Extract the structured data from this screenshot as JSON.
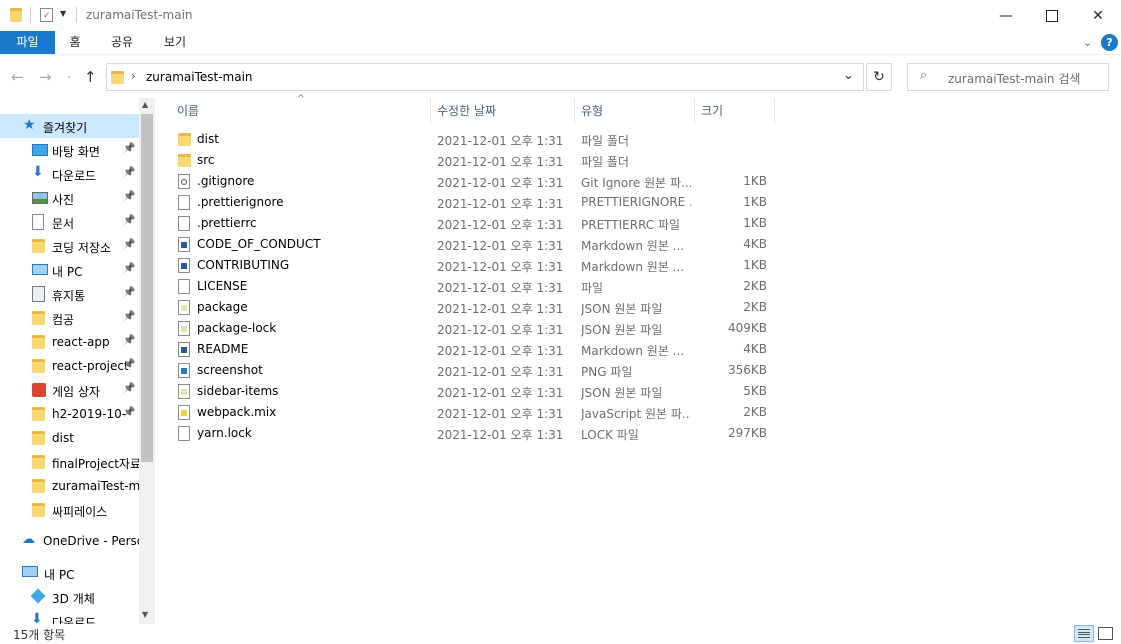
{
  "window": {
    "title": "zuramaiTest-main",
    "minimize_icon": "minimize-icon",
    "maximize_icon": "maximize-icon",
    "close_icon": "close-icon"
  },
  "ribbon": {
    "tabs": [
      "파일",
      "홈",
      "공유",
      "보기"
    ]
  },
  "address": {
    "path_separator": "›",
    "path": "zuramaiTest-main",
    "search_placeholder": "zuramaiTest-main 검색"
  },
  "nav": {
    "quick_access": "즐겨찾기",
    "items": [
      {
        "label": "바탕 화면",
        "icon": "desktop-icon",
        "pinned": true
      },
      {
        "label": "다운로드",
        "icon": "download-icon",
        "pinned": true
      },
      {
        "label": "사진",
        "icon": "pictures-icon",
        "pinned": true
      },
      {
        "label": "문서",
        "icon": "documents-icon",
        "pinned": true
      },
      {
        "label": "코딩 저장소",
        "icon": "folder-icon",
        "pinned": true
      },
      {
        "label": "내 PC",
        "icon": "pc-icon",
        "pinned": true
      },
      {
        "label": "휴지통",
        "icon": "recycle-bin-icon",
        "pinned": true
      },
      {
        "label": "컴공",
        "icon": "folder-icon",
        "pinned": true
      },
      {
        "label": "react-app",
        "icon": "folder-icon",
        "pinned": true
      },
      {
        "label": "react-project",
        "icon": "folder-icon",
        "pinned": true
      },
      {
        "label": "게임 상자",
        "icon": "game-icon",
        "pinned": true
      },
      {
        "label": "h2-2019-10-",
        "icon": "folder-icon",
        "pinned": true
      },
      {
        "label": "dist",
        "icon": "folder-icon",
        "pinned": false
      },
      {
        "label": "finalProject자료",
        "icon": "folder-icon",
        "pinned": false
      },
      {
        "label": "zuramaiTest-ma",
        "icon": "folder-icon",
        "pinned": false
      },
      {
        "label": "싸피레이스",
        "icon": "folder-icon",
        "pinned": false
      }
    ],
    "onedrive": "OneDrive - Persor",
    "this_pc": "내 PC",
    "pc_items": [
      "3D 개체",
      "다운로드"
    ]
  },
  "columns": {
    "name": "이름",
    "date": "수정한 날짜",
    "type": "유형",
    "size": "크기"
  },
  "files": [
    {
      "name": "dist",
      "date": "2021-12-01 오후 1:31",
      "type": "파일 폴더",
      "size": "",
      "icon": "folder-icon"
    },
    {
      "name": "src",
      "date": "2021-12-01 오후 1:31",
      "type": "파일 폴더",
      "size": "",
      "icon": "folder-icon"
    },
    {
      "name": ".gitignore",
      "date": "2021-12-01 오후 1:31",
      "type": "Git Ignore 원본 파...",
      "size": "1KB",
      "icon": "gear-file-icon"
    },
    {
      "name": ".prettierignore",
      "date": "2021-12-01 오후 1:31",
      "type": "PRETTIERIGNORE ...",
      "size": "1KB",
      "icon": "file-icon"
    },
    {
      "name": ".prettierrc",
      "date": "2021-12-01 오후 1:31",
      "type": "PRETTIERRC 파일",
      "size": "1KB",
      "icon": "file-icon"
    },
    {
      "name": "CODE_OF_CONDUCT",
      "date": "2021-12-01 오후 1:31",
      "type": "Markdown 원본 ...",
      "size": "4KB",
      "icon": "markdown-file-icon"
    },
    {
      "name": "CONTRIBUTING",
      "date": "2021-12-01 오후 1:31",
      "type": "Markdown 원본 ...",
      "size": "1KB",
      "icon": "markdown-file-icon"
    },
    {
      "name": "LICENSE",
      "date": "2021-12-01 오후 1:31",
      "type": "파일",
      "size": "2KB",
      "icon": "file-icon"
    },
    {
      "name": "package",
      "date": "2021-12-01 오후 1:31",
      "type": "JSON 원본 파일",
      "size": "2KB",
      "icon": "json-file-icon"
    },
    {
      "name": "package-lock",
      "date": "2021-12-01 오후 1:31",
      "type": "JSON 원본 파일",
      "size": "409KB",
      "icon": "json-file-icon"
    },
    {
      "name": "README",
      "date": "2021-12-01 오후 1:31",
      "type": "Markdown 원본 ...",
      "size": "4KB",
      "icon": "markdown-file-icon"
    },
    {
      "name": "screenshot",
      "date": "2021-12-01 오후 1:31",
      "type": "PNG 파일",
      "size": "356KB",
      "icon": "image-file-icon"
    },
    {
      "name": "sidebar-items",
      "date": "2021-12-01 오후 1:31",
      "type": "JSON 원본 파일",
      "size": "5KB",
      "icon": "json-file-icon"
    },
    {
      "name": "webpack.mix",
      "date": "2021-12-01 오후 1:31",
      "type": "JavaScript 원본 파...",
      "size": "2KB",
      "icon": "js-file-icon"
    },
    {
      "name": "yarn.lock",
      "date": "2021-12-01 오후 1:31",
      "type": "LOCK 파일",
      "size": "297KB",
      "icon": "file-icon"
    }
  ],
  "status": {
    "item_count": "15개 항목"
  },
  "colors": {
    "accent": "#1979ca",
    "selected_nav": "#cce8ff",
    "folder": "#f8d775"
  }
}
